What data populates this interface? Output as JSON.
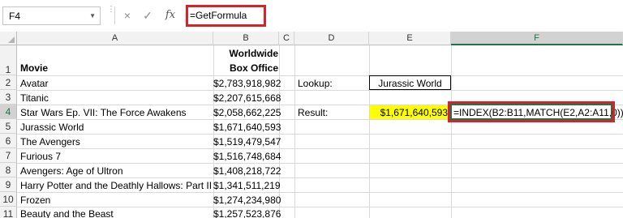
{
  "formula_bar": {
    "name_box": "F4",
    "cancel_icon": "×",
    "enter_icon": "✓",
    "fx_label": "fx",
    "formula": "=GetFormula"
  },
  "columns": [
    "A",
    "B",
    "C",
    "D",
    "E",
    "F"
  ],
  "rows": [
    "1",
    "2",
    "3",
    "4",
    "5",
    "6",
    "7",
    "8",
    "9",
    "10",
    "11"
  ],
  "header": {
    "movie": "Movie",
    "box_office_line1": "Worldwide",
    "box_office_line2": "Box Office"
  },
  "movies": [
    {
      "title": "Avatar",
      "gross": "$2,783,918,982"
    },
    {
      "title": "Titanic",
      "gross": "$2,207,615,668"
    },
    {
      "title": "Star Wars Ep. VII: The Force Awakens",
      "gross": "$2,058,662,225"
    },
    {
      "title": "Jurassic World",
      "gross": "$1,671,640,593"
    },
    {
      "title": "The Avengers",
      "gross": "$1,519,479,547"
    },
    {
      "title": "Furious 7",
      "gross": "$1,516,748,684"
    },
    {
      "title": "Avengers: Age of Ultron",
      "gross": "$1,408,218,722"
    },
    {
      "title": "Harry Potter and the Deathly Hallows: Part II",
      "gross": "$1,341,511,219"
    },
    {
      "title": "Frozen",
      "gross": "$1,274,234,980"
    },
    {
      "title": "Beauty and the Beast",
      "gross": "$1,257,523,876"
    }
  ],
  "lookup": {
    "label": "Lookup:",
    "value": "Jurassic World"
  },
  "result": {
    "label": "Result:",
    "value": "$1,671,640,593",
    "formula_text": "=INDEX(B2:B11,MATCH(E2,A2:A11,0))"
  },
  "colors": {
    "highlight": "#ffff00",
    "annotation_box": "#d6232b",
    "selection": "#217346"
  }
}
